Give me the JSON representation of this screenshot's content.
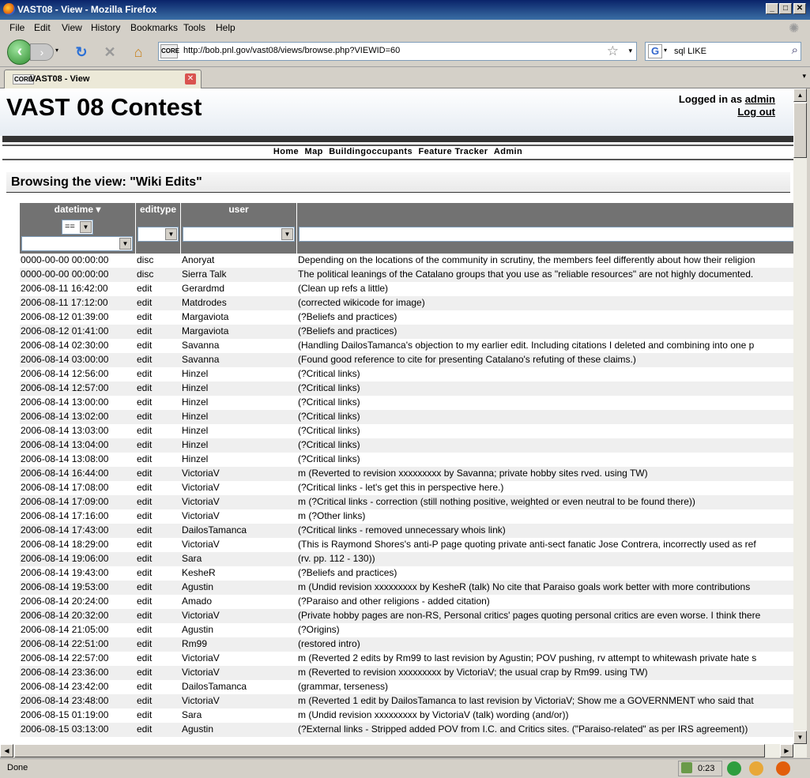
{
  "window": {
    "title": "VAST08 - View - Mozilla Firefox"
  },
  "menu": [
    "File",
    "Edit",
    "View",
    "History",
    "Bookmarks",
    "Tools",
    "Help"
  ],
  "nav": {
    "url": "http://bob.pnl.gov/vast08/views/browse.php?VIEWID=60",
    "search_text": "sql LIKE",
    "site_badge": "CORE"
  },
  "tab": {
    "label": "VAST08 - View"
  },
  "page": {
    "title": "VAST 08 Contest",
    "logged_in_prefix": "Logged in as",
    "user": "admin",
    "logout": "Log out",
    "navlinks": [
      "Home",
      "Map",
      "Buildingoccupants",
      "Feature Tracker",
      "Admin"
    ],
    "browse_title": "Browsing the view: \"Wiki Edits\""
  },
  "table": {
    "columns": [
      "datetime ▾",
      "edittype",
      "user",
      ""
    ],
    "filter_operator": "==",
    "rows": [
      [
        "0000-00-00 00:00:00",
        "disc",
        "Anoryat",
        "Depending on the locations of the community in scrutiny, the members feel differently about how their religion"
      ],
      [
        "0000-00-00 00:00:00",
        "disc",
        "Sierra Talk",
        "The political leanings of the Catalano groups that you use as \"reliable resources\" are not highly documented."
      ],
      [
        "2006-08-11 16:42:00",
        "edit",
        "Gerardmd",
        "(Clean up refs a little)"
      ],
      [
        "2006-08-11 17:12:00",
        "edit",
        "Matdrodes",
        "(corrected wikicode for image)"
      ],
      [
        "2006-08-12 01:39:00",
        "edit",
        "Margaviota",
        "(?Beliefs and practices)"
      ],
      [
        "2006-08-12 01:41:00",
        "edit",
        "Margaviota",
        "(?Beliefs and practices)"
      ],
      [
        "2006-08-14 02:30:00",
        "edit",
        "Savanna",
        "(Handling DailosTamanca's objection to my earlier edit. Including citations I deleted and combining into one p"
      ],
      [
        "2006-08-14 03:00:00",
        "edit",
        "Savanna",
        "(Found good reference to cite for presenting Catalano's refuting of these claims.)"
      ],
      [
        "2006-08-14 12:56:00",
        "edit",
        "Hinzel",
        "(?Critical links)"
      ],
      [
        "2006-08-14 12:57:00",
        "edit",
        "Hinzel",
        "(?Critical links)"
      ],
      [
        "2006-08-14 13:00:00",
        "edit",
        "Hinzel",
        "(?Critical links)"
      ],
      [
        "2006-08-14 13:02:00",
        "edit",
        "Hinzel",
        "(?Critical links)"
      ],
      [
        "2006-08-14 13:03:00",
        "edit",
        "Hinzel",
        "(?Critical links)"
      ],
      [
        "2006-08-14 13:04:00",
        "edit",
        "Hinzel",
        "(?Critical links)"
      ],
      [
        "2006-08-14 13:08:00",
        "edit",
        "Hinzel",
        "(?Critical links)"
      ],
      [
        "2006-08-14 16:44:00",
        "edit",
        "VictoriaV",
        "m (Reverted to revision xxxxxxxxx by Savanna; private hobby sites rved. using TW)"
      ],
      [
        "2006-08-14 17:08:00",
        "edit",
        "VictoriaV",
        "(?Critical links - let's get this in perspective here.)"
      ],
      [
        "2006-08-14 17:09:00",
        "edit",
        "VictoriaV",
        "m (?Critical links - correction (still nothing positive, weighted or even neutral to be found there))"
      ],
      [
        "2006-08-14 17:16:00",
        "edit",
        "VictoriaV",
        "m (?Other links)"
      ],
      [
        "2006-08-14 17:43:00",
        "edit",
        "DailosTamanca",
        "(?Critical links - removed unnecessary whois link)"
      ],
      [
        "2006-08-14 18:29:00",
        "edit",
        "VictoriaV",
        "(This is Raymond Shores's anti-P page quoting private anti-sect fanatic Jose Contrera, incorrectly used as ref"
      ],
      [
        "2006-08-14 19:06:00",
        "edit",
        "Sara",
        "(rv. pp. 112 - 130))"
      ],
      [
        "2006-08-14 19:43:00",
        "edit",
        "KesheR",
        "(?Beliefs and practices)"
      ],
      [
        "2006-08-14 19:53:00",
        "edit",
        "Agustin",
        "m (Undid revision xxxxxxxxx by KesheR (talk) No cite that Paraiso goals work better with more contributions"
      ],
      [
        "2006-08-14 20:24:00",
        "edit",
        "Amado",
        "(?Paraiso and other religions - added citation)"
      ],
      [
        "2006-08-14 20:32:00",
        "edit",
        "VictoriaV",
        "(Private hobby pages are non-RS, Personal critics' pages quoting personal critics are even worse. I think there"
      ],
      [
        "2006-08-14 21:05:00",
        "edit",
        "Agustin",
        "(?Origins)"
      ],
      [
        "2006-08-14 22:51:00",
        "edit",
        "Rm99",
        "(restored intro)"
      ],
      [
        "2006-08-14 22:57:00",
        "edit",
        "VictoriaV",
        "m (Reverted 2 edits by Rm99 to last revision by Agustin; POV pushing, rv attempt to whitewash private hate s"
      ],
      [
        "2006-08-14 23:36:00",
        "edit",
        "VictoriaV",
        "m (Reverted to revision xxxxxxxxx by VictoriaV; the usual crap by Rm99. using TW)"
      ],
      [
        "2006-08-14 23:42:00",
        "edit",
        "DailosTamanca",
        "(grammar, terseness)"
      ],
      [
        "2006-08-14 23:48:00",
        "edit",
        "VictoriaV",
        "m (Reverted 1 edit by DailosTamanca to last revision by VictoriaV; Show me a GOVERNMENT who said that"
      ],
      [
        "2006-08-15 01:19:00",
        "edit",
        "Sara",
        "m (Undid revision xxxxxxxxx by VictoriaV (talk) wording (and/or))"
      ],
      [
        "2006-08-15 03:13:00",
        "edit",
        "Agustin",
        "(?External links - Stripped added POV from I.C. and Critics sites. (\"Paraiso-related\" as per IRS agreement))"
      ]
    ]
  },
  "status": {
    "text": "Done",
    "timer": "0:23"
  }
}
